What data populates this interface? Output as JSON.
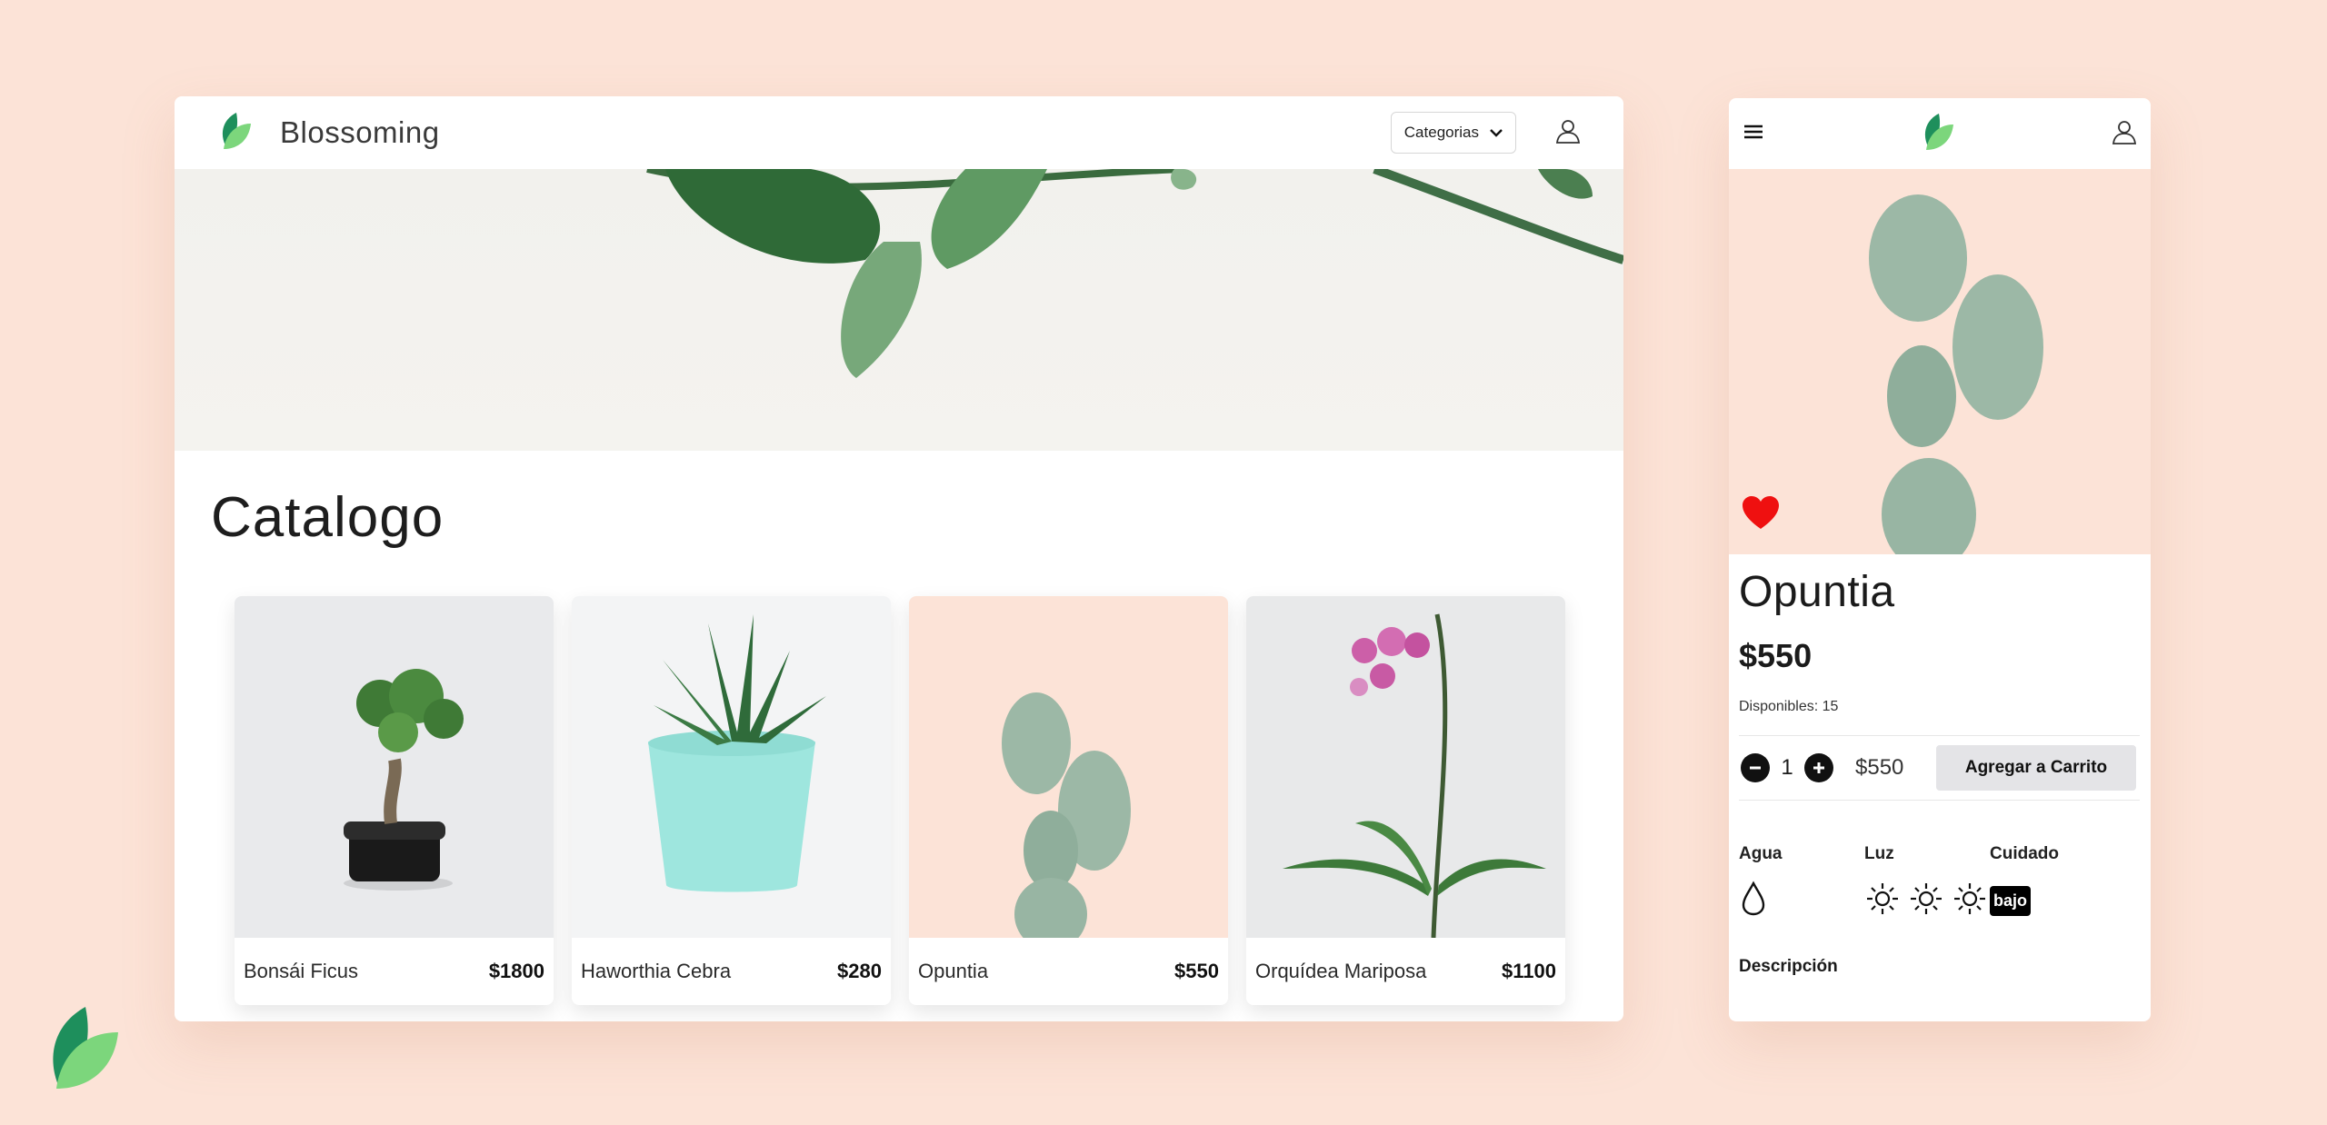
{
  "brand": {
    "name": "Blossoming",
    "colors": {
      "leaf_dark": "#1e8f5c",
      "leaf_light": "#7cd67c",
      "accent_bg": "#fce3d7"
    }
  },
  "header": {
    "categories_label": "Categorias",
    "icons": [
      "leaf-logo-icon",
      "chevron-down-icon",
      "user-icon"
    ]
  },
  "catalog": {
    "title": "Catalogo",
    "products": [
      {
        "name": "Bonsái Ficus",
        "price": "$1800"
      },
      {
        "name": "Haworthia Cebra",
        "price": "$280"
      },
      {
        "name": "Opuntia",
        "price": "$550"
      },
      {
        "name": "Orquídea Mariposa",
        "price": "$1100"
      }
    ]
  },
  "mobile": {
    "icons": [
      "menu-icon",
      "leaf-logo-icon",
      "user-icon",
      "heart-icon"
    ],
    "product": {
      "name": "Opuntia",
      "price": "$550",
      "stock": "Disponibles: 15",
      "quantity": "1",
      "line_total": "$550",
      "add_to_cart": "Agregar a Carrito"
    },
    "care": {
      "water_label": "Agua",
      "light_label": "Luz",
      "care_label": "Cuidado",
      "care_value": "bajo",
      "water_level": 1,
      "light_level": 3
    },
    "description_label": "Descripción"
  }
}
